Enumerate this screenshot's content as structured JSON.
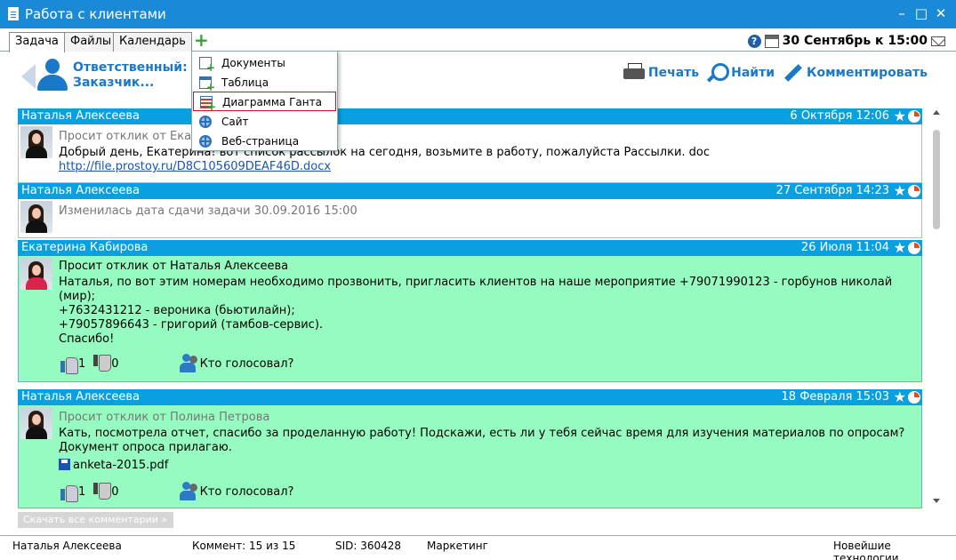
{
  "window": {
    "title": "Работа с клиентами",
    "minimize_label": "–",
    "maximize_label": "□",
    "close_label": "✕"
  },
  "tabs": [
    {
      "label": "Задача"
    },
    {
      "label": "Файлы"
    },
    {
      "label": "Календарь"
    }
  ],
  "tab_add_label": "+",
  "topbar": {
    "help_label": "?",
    "due_date": "30 Сентябрь к 15:00"
  },
  "header": {
    "responsible_label": "Ответственный: П",
    "customer_label": "Заказчик...",
    "actions": {
      "print": "Печать",
      "find": "Найти",
      "comment": "Комментировать"
    }
  },
  "menu": {
    "items": [
      {
        "label": "Документы",
        "icon": "document-add-icon"
      },
      {
        "label": "Таблица",
        "icon": "table-add-icon"
      },
      {
        "label": "Диаграмма Ганта",
        "icon": "gantt-add-icon"
      },
      {
        "label": "Сайт",
        "icon": "globe-icon"
      },
      {
        "label": "Веб-страница",
        "icon": "globe-icon"
      }
    ]
  },
  "star_glyph": "★",
  "comments": [
    {
      "author": "Наталья Алексеева",
      "date": "6 Октября 12:06",
      "meta": "Просит отклик от Екатер",
      "text": "Добрый день, Екатерина! вот список рассылок на сегодня, возьмите в работу, пожалуйста Рассылки. doc",
      "link": "http://file.prostoy.ru/D8C105609DEAF46D.docx"
    },
    {
      "author": "Наталья Алексеева",
      "date": "27 Сентября 14:23",
      "meta": "Изменилась дата сдачи задачи 30.09.2016 15:00"
    },
    {
      "author": "Екатерина Кабирова",
      "date": "26 Июля 11:04",
      "meta": "Просит отклик от Наталья Алексеева",
      "lines": [
        "Наталья, по вот этим номерам необходимо прозвонить, пригласить клиентов на наше мероприятие +79071990123 - горбунов николай",
        "(мир);",
        "+7632431212 - вероника (бьютилайн);",
        "+79057896643 - григорий (тамбов-сервис).",
        "Спасибо!"
      ],
      "likes": "1",
      "dislikes": "0",
      "voters_label": "Кто голосовал?"
    },
    {
      "author": "Наталья Алексеева",
      "date": "18 Февраля 15:03",
      "meta": "Просит отклик от Полина Петрова",
      "lines": [
        "Кать, посмотрела отчет, спасибо за проделанную работу! Подскажи, есть ли у тебя сейчас время для изучения материалов по опросам?",
        "Документ опроса прилагаю."
      ],
      "attachment": "anketa-2015.pdf",
      "likes": "1",
      "dislikes": "0",
      "voters_label": "Кто голосовал?"
    }
  ],
  "download_all_label": "Скачать все комментарии  »",
  "statusbar": {
    "user": "Наталья Алексеева",
    "comments": "Коммент: 15 из 15",
    "sid": "SID: 360428",
    "department": "Маркетинг",
    "company": "Новейшие технологии"
  }
}
